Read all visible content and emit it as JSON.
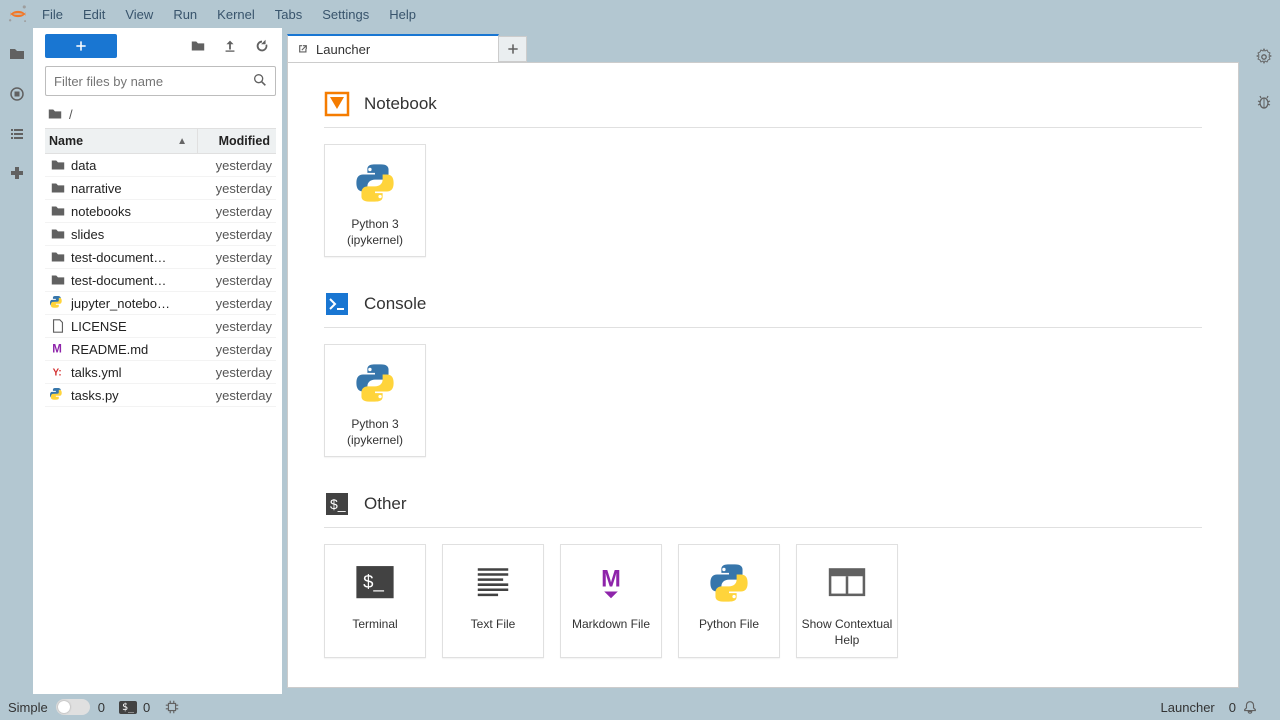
{
  "menubar": [
    "File",
    "Edit",
    "View",
    "Run",
    "Kernel",
    "Tabs",
    "Settings",
    "Help"
  ],
  "file_panel": {
    "filter_placeholder": "Filter files by name",
    "breadcrumb": "/",
    "columns": {
      "name": "Name",
      "modified": "Modified"
    },
    "rows": [
      {
        "icon": "folder",
        "name": "data",
        "modified": "yesterday"
      },
      {
        "icon": "folder",
        "name": "narrative",
        "modified": "yesterday"
      },
      {
        "icon": "folder",
        "name": "notebooks",
        "modified": "yesterday"
      },
      {
        "icon": "folder",
        "name": "slides",
        "modified": "yesterday"
      },
      {
        "icon": "folder",
        "name": "test-document…",
        "modified": "yesterday"
      },
      {
        "icon": "folder",
        "name": "test-document…",
        "modified": "yesterday"
      },
      {
        "icon": "python",
        "name": "jupyter_notebo…",
        "modified": "yesterday"
      },
      {
        "icon": "file",
        "name": "LICENSE",
        "modified": "yesterday"
      },
      {
        "icon": "md",
        "name": "README.md",
        "modified": "yesterday"
      },
      {
        "icon": "yaml",
        "name": "talks.yml",
        "modified": "yesterday"
      },
      {
        "icon": "python",
        "name": "tasks.py",
        "modified": "yesterday"
      }
    ]
  },
  "tab": {
    "label": "Launcher"
  },
  "launcher": {
    "sections": [
      {
        "title": "Notebook",
        "icon": "notebook",
        "cards": [
          {
            "icon": "python",
            "label": "Python 3 (ipykernel)"
          }
        ]
      },
      {
        "title": "Console",
        "icon": "console",
        "cards": [
          {
            "icon": "python",
            "label": "Python 3 (ipykernel)"
          }
        ]
      },
      {
        "title": "Other",
        "icon": "terminal",
        "cards": [
          {
            "icon": "terminal",
            "label": "Terminal"
          },
          {
            "icon": "textfile",
            "label": "Text File"
          },
          {
            "icon": "markdown",
            "label": "Markdown File"
          },
          {
            "icon": "python",
            "label": "Python File"
          },
          {
            "icon": "help",
            "label": "Show Contextual Help"
          }
        ]
      }
    ]
  },
  "statusbar": {
    "simple": "Simple",
    "count1": "0",
    "count2": "0",
    "right_label": "Launcher",
    "right_count": "0"
  }
}
